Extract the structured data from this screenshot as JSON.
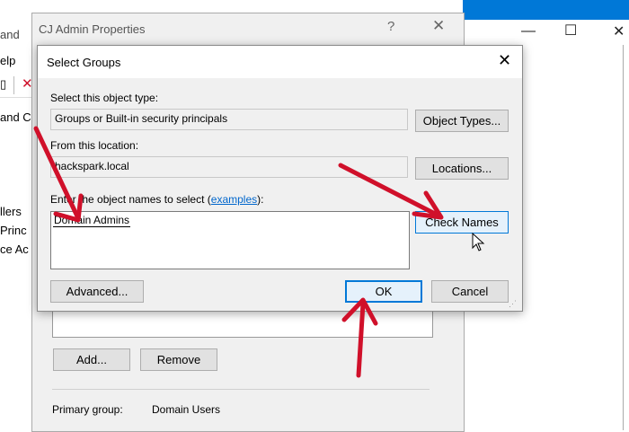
{
  "background": {
    "title_fragment": "and",
    "menu_fragment": "elp",
    "tree_items": [
      "and C",
      "",
      "",
      "",
      "",
      "llers",
      "Princ",
      "ce Ac"
    ]
  },
  "props_dialog": {
    "title": "CJ Admin Properties",
    "help_glyph": "?",
    "close_glyph": "✕",
    "add_label": "Add...",
    "remove_label": "Remove",
    "primary_group_label": "Primary group:",
    "primary_group_value": "Domain Users"
  },
  "select_groups": {
    "title": "Select Groups",
    "close_glyph": "✕",
    "object_type_label": "Select this object type:",
    "object_type_value": "Groups or Built-in security principals",
    "object_types_button": "Object Types...",
    "location_label": "From this location:",
    "location_value": "hackspark.local",
    "locations_button": "Locations...",
    "names_label_prefix": "Enter the object names to select (",
    "names_label_link": "examples",
    "names_label_suffix": "):",
    "names_value": "Domain Admins",
    "check_names_button": "Check Names",
    "advanced_button": "Advanced...",
    "ok_button": "OK",
    "cancel_button": "Cancel"
  },
  "colors": {
    "annotation_arrow": "#d0102a",
    "accent": "#0078d7",
    "link": "#0066cc"
  }
}
